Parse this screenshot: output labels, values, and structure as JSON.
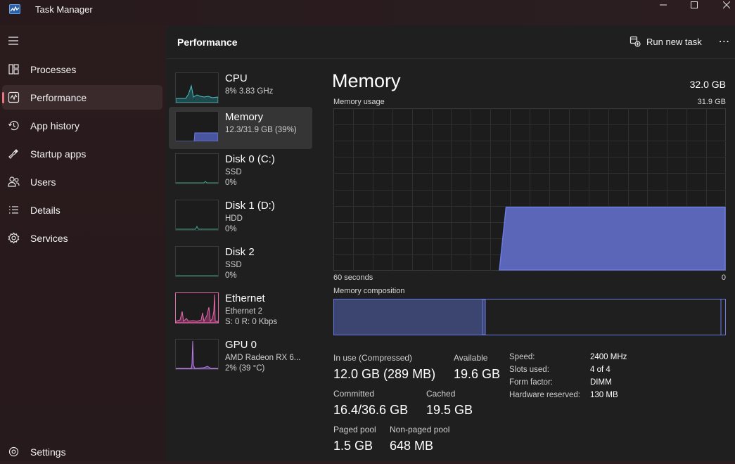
{
  "window": {
    "title": "Task Manager"
  },
  "nav": {
    "items": [
      {
        "label": "Processes",
        "icon": "processes-icon"
      },
      {
        "label": "Performance",
        "icon": "performance-icon",
        "active": true
      },
      {
        "label": "App history",
        "icon": "history-icon"
      },
      {
        "label": "Startup apps",
        "icon": "startup-icon"
      },
      {
        "label": "Users",
        "icon": "users-icon"
      },
      {
        "label": "Details",
        "icon": "details-icon"
      },
      {
        "label": "Services",
        "icon": "services-icon"
      }
    ],
    "settings": "Settings"
  },
  "header": {
    "title": "Performance",
    "run_new_task": "Run new task",
    "more": "⋯"
  },
  "devices": [
    {
      "name": "CPU",
      "line2": "8% 3.83 GHz",
      "line3": "",
      "color": "#4cc2c4"
    },
    {
      "name": "Memory",
      "line2": "12.3/31.9 GB (39%)",
      "line3": "",
      "color": "#6a7be0",
      "active": true
    },
    {
      "name": "Disk 0 (C:)",
      "line2": "SSD",
      "line3": "0%",
      "color": "#3fa88c"
    },
    {
      "name": "Disk 1 (D:)",
      "line2": "HDD",
      "line3": "0%",
      "color": "#3fa88c"
    },
    {
      "name": "Disk 2",
      "line2": "SSD",
      "line3": "0%",
      "color": "#3fa88c"
    },
    {
      "name": "Ethernet",
      "line2": "Ethernet 2",
      "line3": "S: 0 R: 0 Kbps",
      "color": "#e36aa8"
    },
    {
      "name": "GPU 0",
      "line2": "AMD Radeon RX 6...",
      "line3": "2% (39 °C)",
      "color": "#b77ce6"
    }
  ],
  "memory": {
    "title": "Memory",
    "total": "32.0 GB",
    "usage_label": "Memory usage",
    "usage_max": "31.9 GB",
    "x_left": "60 seconds",
    "x_right": "0",
    "composition_label": "Memory composition",
    "usage_history_fraction": [
      0,
      0,
      0,
      0,
      0,
      0,
      0,
      0,
      0,
      0,
      0,
      0,
      0,
      0,
      0,
      0,
      0,
      0,
      0,
      0,
      0,
      0,
      0,
      0,
      0,
      0,
      0.39,
      0.39,
      0.39,
      0.39,
      0.39,
      0.39,
      0.39,
      0.39,
      0.39,
      0.39,
      0.39,
      0.39,
      0.39,
      0.39,
      0.39,
      0.39,
      0.39,
      0.39,
      0.39,
      0.39,
      0.39,
      0.39,
      0.39,
      0.39,
      0.39,
      0.39,
      0.39,
      0.39,
      0.39,
      0.39,
      0.39,
      0.39,
      0.39,
      0.39
    ],
    "stats": {
      "in_use_label": "In use (Compressed)",
      "in_use_value": "12.0 GB (289 MB)",
      "available_label": "Available",
      "available_value": "19.6 GB",
      "committed_label": "Committed",
      "committed_value": "16.4/36.6 GB",
      "cached_label": "Cached",
      "cached_value": "19.5 GB",
      "paged_label": "Paged pool",
      "paged_value": "1.5 GB",
      "nonpaged_label": "Non-paged pool",
      "nonpaged_value": "648 MB"
    },
    "specs": [
      {
        "label": "Speed:",
        "value": "2400 MHz"
      },
      {
        "label": "Slots used:",
        "value": "4 of 4"
      },
      {
        "label": "Form factor:",
        "value": "DIMM"
      },
      {
        "label": "Hardware reserved:",
        "value": "130 MB"
      }
    ]
  },
  "colors": {
    "accent": "#6a7be0",
    "nav_indicator": "#e8757f"
  }
}
